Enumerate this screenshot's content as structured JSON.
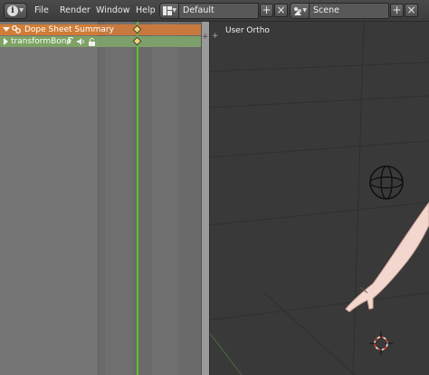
{
  "topbar": {
    "editor_icon": "info-icon",
    "menus": [
      "File",
      "Render",
      "Window",
      "Help"
    ],
    "layout": {
      "icon": "screen-layout-icon",
      "value": "Default",
      "add": "+",
      "remove": "×"
    },
    "scene": {
      "icon": "scene-icon",
      "value": "Scene",
      "add": "+",
      "remove": "×"
    }
  },
  "dopesheet": {
    "summary_label": "Dope Sheet Summary",
    "channel_label": "transformBone",
    "channel_color": "#7da264",
    "summary_color": "#d07d36",
    "playhead_color": "#59c02e",
    "keyframe_color": "#f0d57a"
  },
  "viewport": {
    "label": "User Ortho",
    "background": "#393939"
  }
}
